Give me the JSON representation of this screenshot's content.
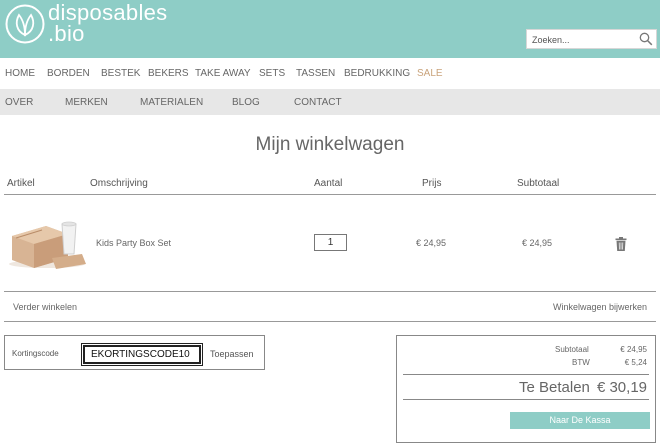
{
  "brand": {
    "line1": "disposables",
    "line2": ".bio",
    "color": "#8ecdc6"
  },
  "search": {
    "placeholder": "Zoeken..."
  },
  "nav_primary": [
    "HOME",
    "BORDEN",
    "BESTEK",
    "BEKERS",
    "TAKE AWAY",
    "SETS",
    "TASSEN",
    "BEDRUKKING",
    "SALE"
  ],
  "nav_secondary": [
    "OVER",
    "MERKEN",
    "MATERIALEN",
    "BLOG",
    "CONTACT"
  ],
  "page_title": "Mijn winkelwagen",
  "cart": {
    "headers": {
      "article": "Artikel",
      "description": "Omschrijving",
      "quantity": "Aantal",
      "price": "Prijs",
      "subtotal": "Subtotaal"
    },
    "items": [
      {
        "description": "Kids Party Box Set",
        "quantity": "1",
        "price": "€ 24,95",
        "subtotal": "€ 24,95",
        "image": "kids-party-box-image",
        "remove_icon": "trash-icon"
      }
    ],
    "continue_shopping": "Verder winkelen",
    "update_cart": "Winkelwagen bijwerken"
  },
  "coupon": {
    "label": "Kortingscode",
    "value": "EKORTINGSCODE10",
    "apply": "Toepassen"
  },
  "totals": {
    "subtotal_label": "Subtotaal",
    "subtotal_value": "€ 24,95",
    "tax_label": "BTW",
    "tax_value": "€ 5,24",
    "grand_label": "Te Betalen",
    "grand_value": "€ 30,19",
    "checkout": "Naar De Kassa"
  }
}
